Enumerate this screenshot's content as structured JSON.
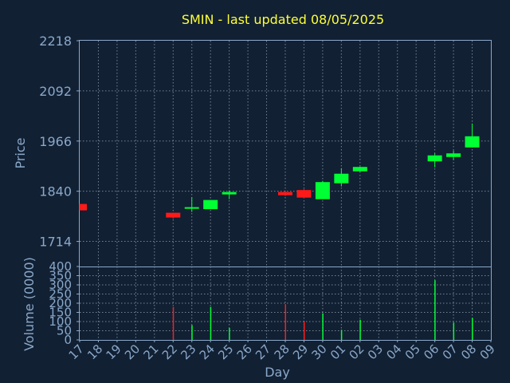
{
  "chart_data": {
    "type": "candlestick",
    "title": "SMIN - last updated 08/05/2025",
    "xlabel": "Day",
    "colors": {
      "up": "#00ff33",
      "down": "#ff1a1a",
      "background": "#112033",
      "title": "#ffff33",
      "axis": "#8aa8c9"
    },
    "grid": true,
    "categories": [
      "17",
      "18",
      "19",
      "20",
      "21",
      "22",
      "23",
      "24",
      "25",
      "26",
      "27",
      "28",
      "29",
      "30",
      "01",
      "02",
      "03",
      "04",
      "05",
      "06",
      "07",
      "08",
      "09"
    ],
    "price": {
      "ylabel": "Price",
      "ylim": [
        1651,
        2218
      ],
      "ticks": [
        1714,
        1840,
        1966,
        2092,
        2218
      ],
      "candles": [
        {
          "day": "17",
          "open": 1808,
          "high": 1808,
          "low": 1792,
          "close": 1792
        },
        {
          "day": "22",
          "open": 1786,
          "high": 1786,
          "low": 1771,
          "close": 1774
        },
        {
          "day": "23",
          "open": 1797,
          "high": 1825,
          "low": 1788,
          "close": 1800
        },
        {
          "day": "24",
          "open": 1795,
          "high": 1818,
          "low": 1795,
          "close": 1818
        },
        {
          "day": "25",
          "open": 1832,
          "high": 1842,
          "low": 1820,
          "close": 1838
        },
        {
          "day": "28",
          "open": 1838,
          "high": 1842,
          "low": 1828,
          "close": 1830
        },
        {
          "day": "29",
          "open": 1843,
          "high": 1845,
          "low": 1822,
          "close": 1824
        },
        {
          "day": "30",
          "open": 1820,
          "high": 1866,
          "low": 1820,
          "close": 1863
        },
        {
          "day": "01",
          "open": 1860,
          "high": 1898,
          "low": 1852,
          "close": 1884
        },
        {
          "day": "02",
          "open": 1890,
          "high": 1902,
          "low": 1888,
          "close": 1901
        },
        {
          "day": "06",
          "open": 1915,
          "high": 1935,
          "low": 1900,
          "close": 1930
        },
        {
          "day": "07",
          "open": 1926,
          "high": 1942,
          "low": 1918,
          "close": 1935
        },
        {
          "day": "08",
          "open": 1950,
          "high": 2010,
          "low": 1950,
          "close": 1978
        }
      ]
    },
    "volume": {
      "ylabel": "Volume (0000)",
      "ylim": [
        0,
        400
      ],
      "ticks": [
        0,
        50,
        100,
        150,
        200,
        250,
        300,
        350,
        400
      ],
      "bars": [
        {
          "day": "22",
          "value": 180,
          "dir": "down"
        },
        {
          "day": "23",
          "value": 80,
          "dir": "up"
        },
        {
          "day": "24",
          "value": 180,
          "dir": "up"
        },
        {
          "day": "25",
          "value": 65,
          "dir": "up"
        },
        {
          "day": "28",
          "value": 195,
          "dir": "down"
        },
        {
          "day": "29",
          "value": 100,
          "dir": "down"
        },
        {
          "day": "30",
          "value": 145,
          "dir": "up"
        },
        {
          "day": "01",
          "value": 55,
          "dir": "up"
        },
        {
          "day": "02",
          "value": 110,
          "dir": "up"
        },
        {
          "day": "06",
          "value": 325,
          "dir": "up"
        },
        {
          "day": "07",
          "value": 95,
          "dir": "up"
        },
        {
          "day": "08",
          "value": 120,
          "dir": "up"
        }
      ]
    }
  }
}
